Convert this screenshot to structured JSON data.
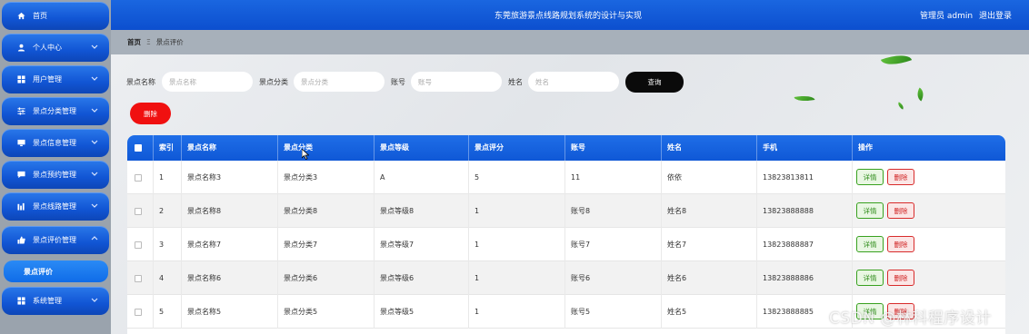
{
  "header": {
    "title": "东莞旅游景点线路规划系统的设计与实现",
    "admin": "管理员 admin",
    "logout": "退出登录"
  },
  "sidebar": {
    "items": [
      {
        "label": "首页",
        "icon": "home-icon"
      },
      {
        "label": "个人中心",
        "icon": "user-icon"
      },
      {
        "label": "用户管理",
        "icon": "grid-icon"
      },
      {
        "label": "景点分类管理",
        "icon": "sliders-icon"
      },
      {
        "label": "景点信息管理",
        "icon": "monitor-icon"
      },
      {
        "label": "景点预约管理",
        "icon": "chat-icon"
      },
      {
        "label": "景点线路管理",
        "icon": "chart-icon"
      },
      {
        "label": "景点评价管理",
        "icon": "thumb-icon"
      },
      {
        "label": "系统管理",
        "icon": "grid-icon"
      }
    ],
    "sub_item": "景点评价"
  },
  "breadcrumb": {
    "home": "首页",
    "separator": "Ξ",
    "current": "景点评价"
  },
  "search": {
    "fields": [
      {
        "label": "景点名称",
        "placeholder": "景点名称"
      },
      {
        "label": "景点分类",
        "placeholder": "景点分类"
      },
      {
        "label": "账号",
        "placeholder": "账号"
      },
      {
        "label": "姓名",
        "placeholder": "姓名"
      }
    ],
    "query_label": "查询"
  },
  "actions": {
    "delete_label": "删除"
  },
  "table": {
    "columns": [
      "",
      "索引",
      "景点名称",
      "景点分类",
      "景点等级",
      "景点评分",
      "账号",
      "姓名",
      "手机",
      "操作"
    ],
    "rows": [
      {
        "index": "1",
        "name": "景点名称3",
        "category": "景点分类3",
        "level": "A",
        "score": "5",
        "account": "11",
        "person": "依依",
        "phone": "13823813811"
      },
      {
        "index": "2",
        "name": "景点名称8",
        "category": "景点分类8",
        "level": "景点等级8",
        "score": "1",
        "account": "账号8",
        "person": "姓名8",
        "phone": "13823888888"
      },
      {
        "index": "3",
        "name": "景点名称7",
        "category": "景点分类7",
        "level": "景点等级7",
        "score": "1",
        "account": "账号7",
        "person": "姓名7",
        "phone": "13823888887"
      },
      {
        "index": "4",
        "name": "景点名称6",
        "category": "景点分类6",
        "level": "景点等级6",
        "score": "1",
        "account": "账号6",
        "person": "姓名6",
        "phone": "13823888886"
      },
      {
        "index": "5",
        "name": "景点名称5",
        "category": "景点分类5",
        "level": "景点等级5",
        "score": "1",
        "account": "账号5",
        "person": "姓名5",
        "phone": "13823888885"
      }
    ],
    "detail_label": "详情",
    "delete_label": "删除"
  },
  "watermark": "CSDN @林科程序设计",
  "colors": {
    "accent": "#1155d4",
    "query": "#0a0a0a",
    "delete": "#f01010",
    "detail_border": "#38a11f",
    "delete_border": "#d82b2b"
  }
}
